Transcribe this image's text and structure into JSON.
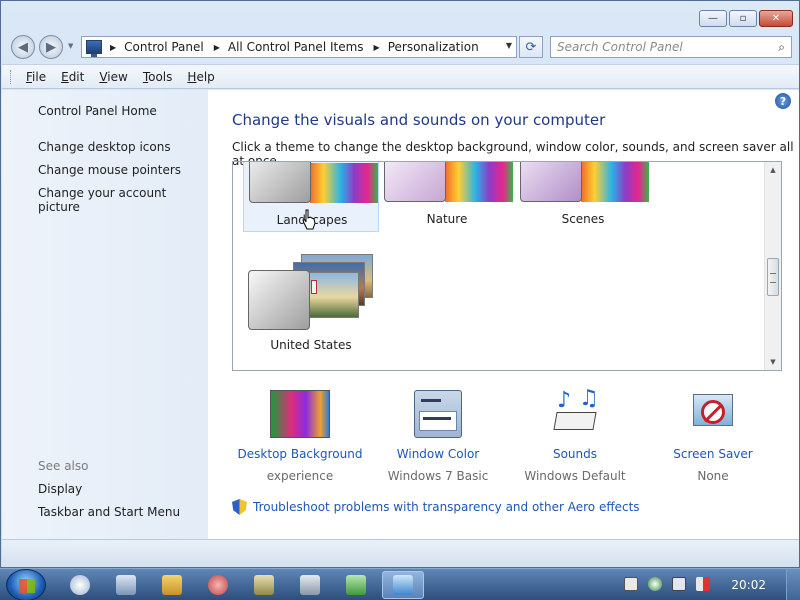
{
  "window": {
    "minimize_symbol": "—",
    "maximize_symbol": "▫",
    "close_symbol": "✕"
  },
  "nav": {
    "back_symbol": "◀",
    "forward_symbol": "▶",
    "breadcrumbs": [
      "Control Panel",
      "All Control Panel Items",
      "Personalization"
    ],
    "breadcrumb_separator": "▶",
    "dropdown_symbol": "▼",
    "refresh_symbol": "⟳",
    "search_placeholder": "Search Control Panel",
    "search_symbol": "⌕"
  },
  "menu": {
    "items": [
      {
        "underline": "F",
        "rest": "ile"
      },
      {
        "underline": "E",
        "rest": "dit"
      },
      {
        "underline": "V",
        "rest": "iew"
      },
      {
        "underline": "T",
        "rest": "ools"
      },
      {
        "underline": "H",
        "rest": "elp"
      }
    ]
  },
  "sidebar": {
    "home": "Control Panel Home",
    "links": [
      "Change desktop icons",
      "Change mouse pointers",
      "Change your account picture"
    ],
    "see_also_label": "See also",
    "see_also": [
      "Display",
      "Taskbar and Start Menu"
    ]
  },
  "main": {
    "help_symbol": "?",
    "title": "Change the visuals and sounds on your computer",
    "description": "Click a theme to change the desktop background, window color, sounds, and screen saver all at once.",
    "themes": [
      "Landscapes",
      "Nature",
      "Scenes",
      "United States"
    ],
    "scroll_up_symbol": "▲",
    "scroll_down_symbol": "▼"
  },
  "tools": [
    {
      "label": "Desktop Background",
      "value": "experience",
      "icon": "desktop-background-icon"
    },
    {
      "label": "Window Color",
      "value": "Windows 7 Basic",
      "icon": "window-color-icon"
    },
    {
      "label": "Sounds",
      "value": "Windows Default",
      "icon": "sounds-icon"
    },
    {
      "label": "Screen Saver",
      "value": "None",
      "icon": "screen-saver-icon"
    }
  ],
  "troubleshoot": {
    "text": "Troubleshoot problems with transparency and other Aero effects"
  },
  "taskbar": {
    "clock": "20:02"
  },
  "colors": {
    "link": "#1c57b8",
    "title": "#1e3a87",
    "sidebar": "#e3ecf7",
    "taskbar": "#2c4f7d"
  }
}
